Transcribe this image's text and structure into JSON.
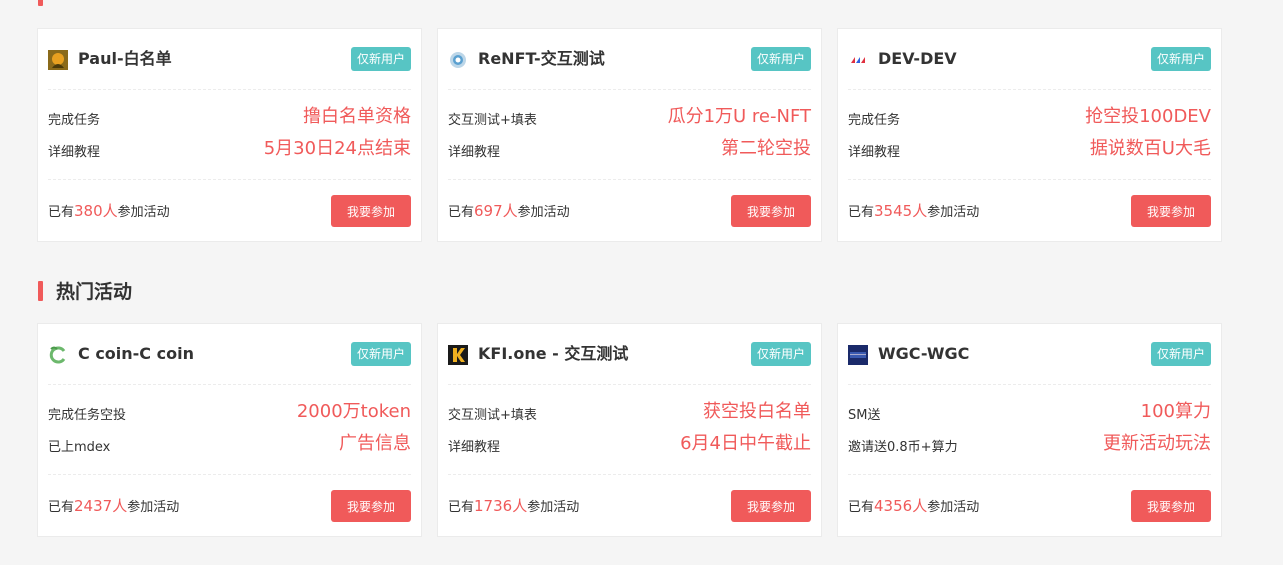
{
  "colors": {
    "accent": "#f05a5a",
    "tag": "#57c5c4",
    "background": "#f5f5f5"
  },
  "sections": [
    {
      "title": "",
      "cards": [
        {
          "icon": "paul-logo-icon",
          "name": "Paul-白名单",
          "tag": "仅新用户",
          "row1_key": "完成任务",
          "row1_value": "撸白名单资格",
          "row2_key": "详细教程",
          "row2_value": "5月30日24点结束",
          "joined_prefix": "已有",
          "joined_count": "380人",
          "joined_suffix": "参加活动",
          "button": "我要参加"
        },
        {
          "icon": "renft-logo-icon",
          "name": "ReNFT-交互测试",
          "tag": "仅新用户",
          "row1_key": "交互测试+填表",
          "row1_value": "瓜分1万U re-NFT",
          "row2_key": "详细教程",
          "row2_value": "第二轮空投",
          "joined_prefix": "已有",
          "joined_count": "697人",
          "joined_suffix": "参加活动",
          "button": "我要参加"
        },
        {
          "icon": "dev-logo-icon",
          "name": "DEV-DEV",
          "tag": "仅新用户",
          "row1_key": "完成任务",
          "row1_value": "抢空投100DEV",
          "row2_key": "详细教程",
          "row2_value": "据说数百U大毛",
          "joined_prefix": "已有",
          "joined_count": "3545人",
          "joined_suffix": "参加活动",
          "button": "我要参加"
        }
      ]
    },
    {
      "title": "热门活动",
      "cards": [
        {
          "icon": "ccoin-logo-icon",
          "name": "C coin-C coin",
          "tag": "仅新用户",
          "row1_key": "完成任务空投",
          "row1_value": "2000万token",
          "row2_key": "已上mdex",
          "row2_value": "广告信息",
          "joined_prefix": "已有",
          "joined_count": "2437人",
          "joined_suffix": "参加活动",
          "button": "我要参加"
        },
        {
          "icon": "kfi-logo-icon",
          "name": "KFI.one - 交互测试",
          "tag": "仅新用户",
          "row1_key": "交互测试+填表",
          "row1_value": "获空投白名单",
          "row2_key": "详细教程",
          "row2_value": "6月4日中午截止",
          "joined_prefix": "已有",
          "joined_count": "1736人",
          "joined_suffix": "参加活动",
          "button": "我要参加"
        },
        {
          "icon": "wgc-logo-icon",
          "name": "WGC-WGC",
          "tag": "仅新用户",
          "row1_key": "SM送",
          "row1_value": "100算力",
          "row2_key": "邀请送0.8币+算力",
          "row2_value": "更新活动玩法",
          "joined_prefix": "已有",
          "joined_count": "4356人",
          "joined_suffix": "参加活动",
          "button": "我要参加"
        }
      ]
    }
  ]
}
